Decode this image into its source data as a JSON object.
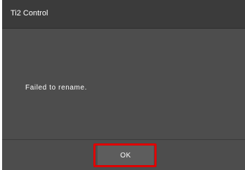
{
  "dialog": {
    "title": "Ti2 Control",
    "message": "Failed to rename.",
    "ok_label": "OK",
    "highlight_color": "#e00000"
  }
}
